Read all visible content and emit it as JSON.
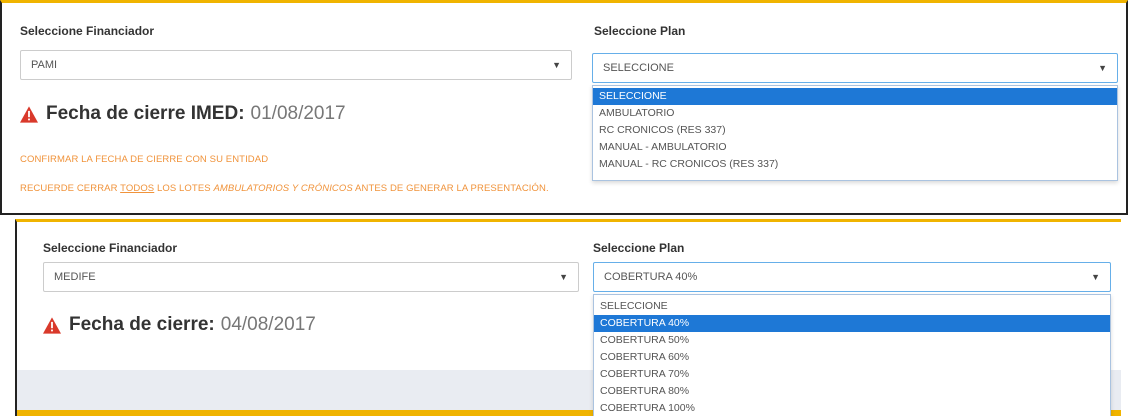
{
  "top": {
    "financiador_label": "Seleccione Financiador",
    "financiador_value": "PAMI",
    "plan_label": "Seleccione Plan",
    "plan_value": "SELECCIONE",
    "plan_options": [
      "SELECCIONE",
      "AMBULATORIO",
      "RC CRONICOS (RES 337)",
      "MANUAL - AMBULATORIO",
      "MANUAL - RC CRONICOS (RES 337)"
    ],
    "plan_selected_index": 0,
    "warning_label": "Fecha de cierre IMED:",
    "warning_date": "01/08/2017",
    "confirm_note": "CONFIRMAR LA FECHA DE CIERRE CON SU ENTIDAD",
    "reminder_pre": "RECUERDE CERRAR ",
    "reminder_todos": "TODOS",
    "reminder_mid": " LOS LOTES ",
    "reminder_italic": "AMBULATORIOS Y CRÓNICOS",
    "reminder_post": " ANTES DE GENERAR LA PRESENTACIÓN."
  },
  "bottom": {
    "financiador_label": "Seleccione Financiador",
    "financiador_value": "MEDIFE",
    "plan_label": "Seleccione Plan",
    "plan_value": "COBERTURA 40%",
    "plan_options": [
      "SELECCIONE",
      "COBERTURA 40%",
      "COBERTURA 50%",
      "COBERTURA 60%",
      "COBERTURA 70%",
      "COBERTURA 80%",
      "COBERTURA 100%"
    ],
    "plan_selected_index": 1,
    "warning_label": "Fecha de cierre:",
    "warning_date": "04/08/2017"
  },
  "icons": {
    "caret": "caret-down-icon",
    "warning": "warning-triangle-icon"
  },
  "colors": {
    "accent": "#f0b400",
    "warning_red": "#d9392b",
    "note_orange": "#f0933b",
    "selected_option": "#1e78d6"
  }
}
